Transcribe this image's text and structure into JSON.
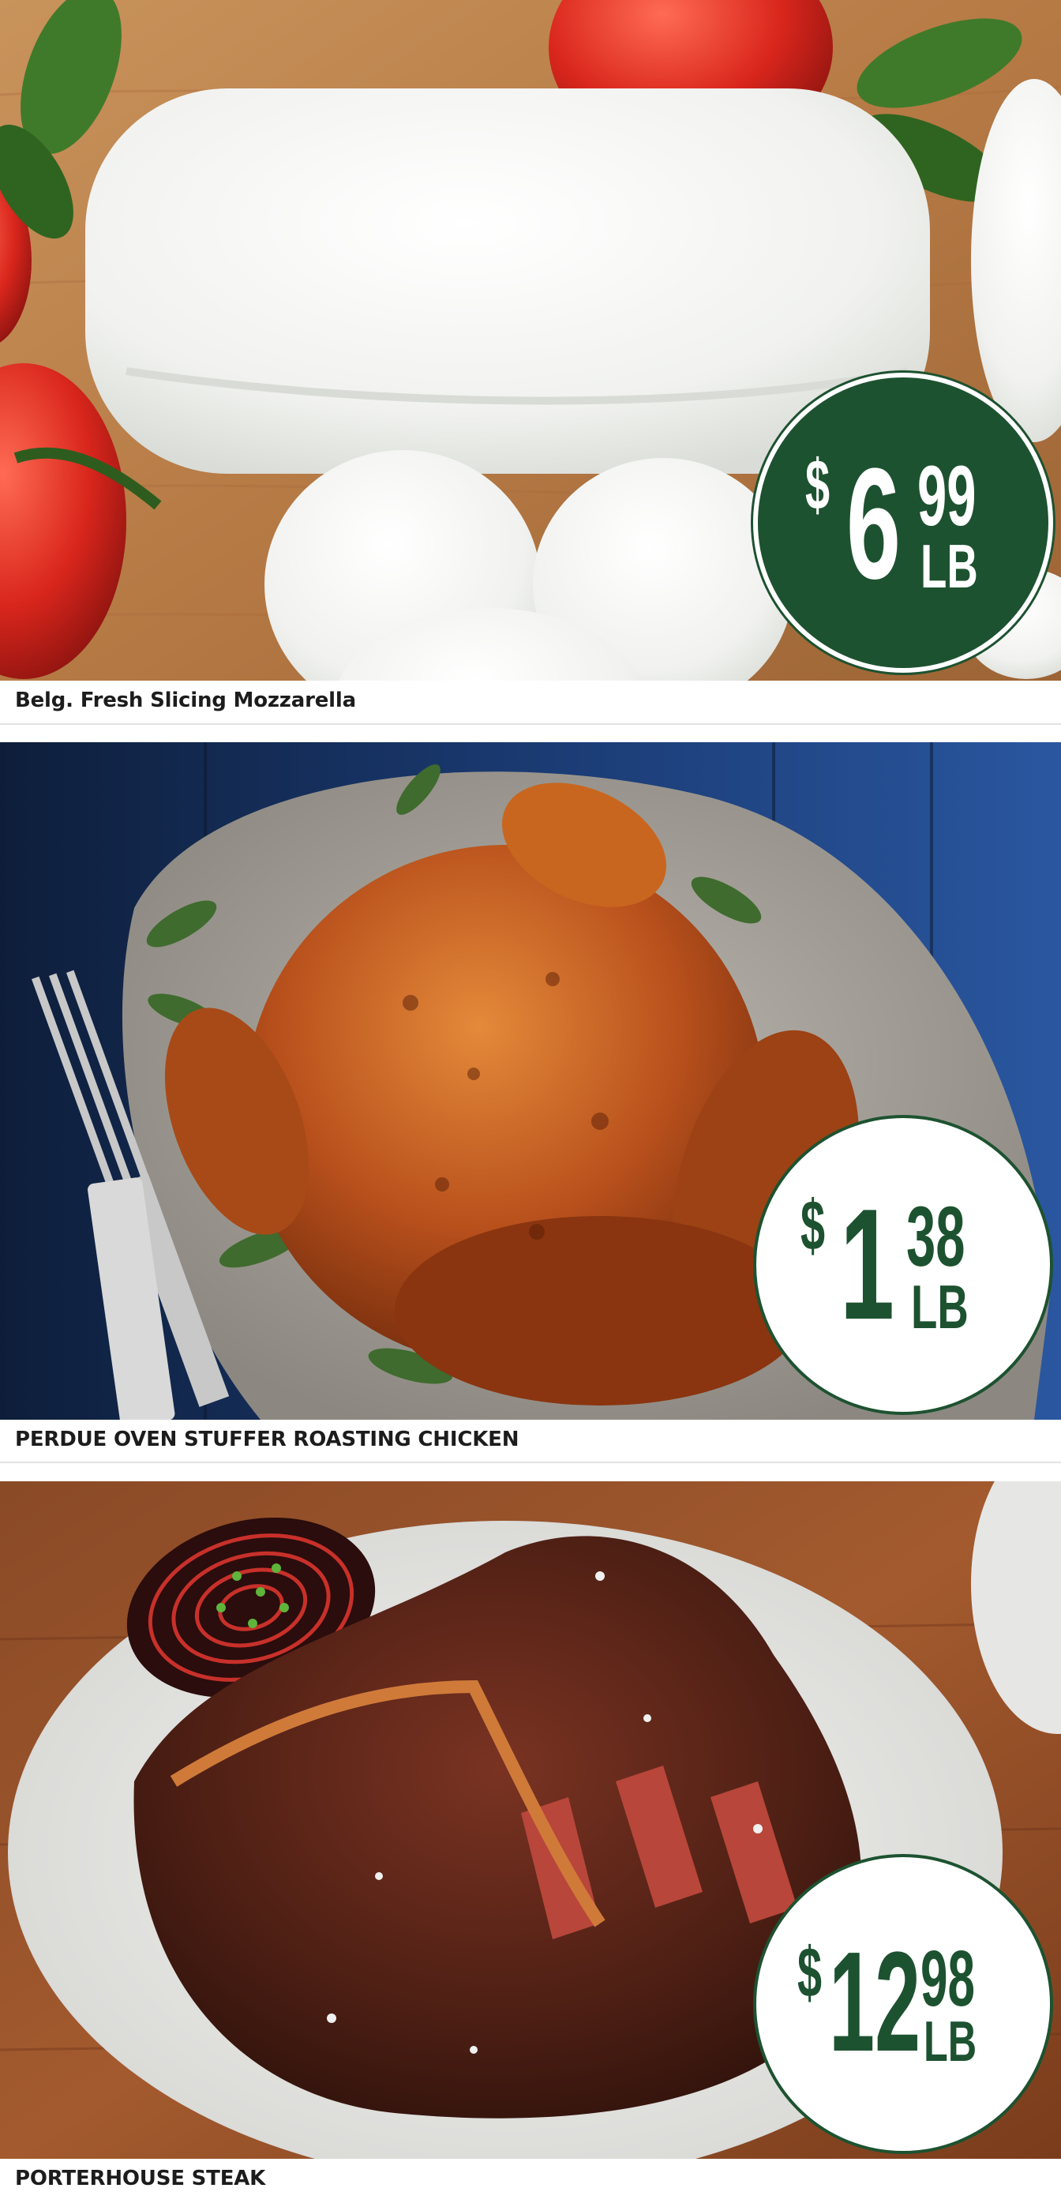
{
  "products": [
    {
      "name": "Belg. Fresh Slicing Mozzarella",
      "price_dollars": "6",
      "price_cents": "99",
      "price_unit": "LB",
      "currency": "$"
    },
    {
      "name": "PERDUE OVEN STUFFER ROASTING CHICKEN",
      "price_dollars": "1",
      "price_cents": "38",
      "price_unit": "LB",
      "currency": "$"
    },
    {
      "name": "PORTERHOUSE STEAK",
      "price_dollars": "12",
      "price_cents": "98",
      "price_unit": "LB",
      "currency": "$"
    }
  ],
  "colors": {
    "badge_green": "#1d5230",
    "badge_white": "#ffffff",
    "caption_text": "#1c1c1c"
  },
  "images": [
    "mozzarella-photo",
    "roast-chicken-photo",
    "porterhouse-steak-photo"
  ]
}
